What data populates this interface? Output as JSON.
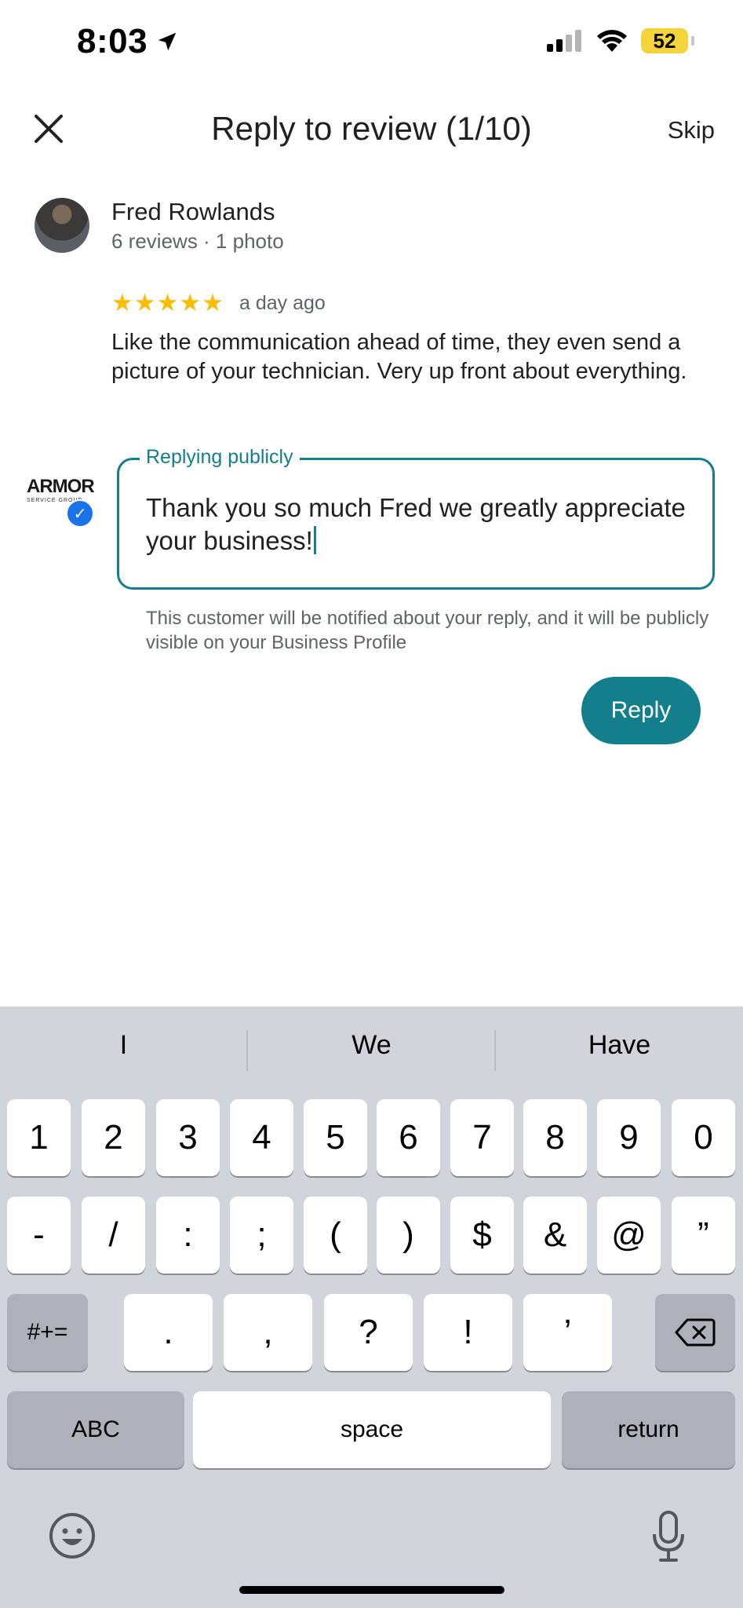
{
  "status_bar": {
    "time": "8:03",
    "battery": "52"
  },
  "header": {
    "title": "Reply to review (1/10)",
    "skip_label": "Skip"
  },
  "review": {
    "reviewer_name": "Fred Rowlands",
    "reviewer_meta": "6 reviews · 1 photo",
    "stars": "★★★★★",
    "rating": 5,
    "time": "a day ago",
    "text": "Like the communication ahead of time, they even send a picture of your technician.  Very up front about everything."
  },
  "business": {
    "logo_text": "ARMOR",
    "logo_subtext": "SERVICE GROUP"
  },
  "reply": {
    "label": "Replying publicly",
    "value": "Thank you so much Fred we greatly appreciate your business!",
    "notice": "This customer will be notified about your reply, and it will be publicly visible on your Business Profile",
    "button_label": "Reply"
  },
  "keyboard": {
    "suggestions": [
      "I",
      "We",
      "Have"
    ],
    "row1": [
      "1",
      "2",
      "3",
      "4",
      "5",
      "6",
      "7",
      "8",
      "9",
      "0"
    ],
    "row2": [
      "-",
      "/",
      ":",
      ";",
      "(",
      ")",
      "$",
      "&",
      "@",
      "”"
    ],
    "row3_mode": "#+=",
    "row3": [
      ".",
      ",",
      "?",
      "!",
      "’"
    ],
    "abc": "ABC",
    "space": "space",
    "return": "return"
  },
  "colors": {
    "accent": "#137f8c",
    "star": "#fbbc04",
    "keyboard_bg": "#d1d4db"
  }
}
